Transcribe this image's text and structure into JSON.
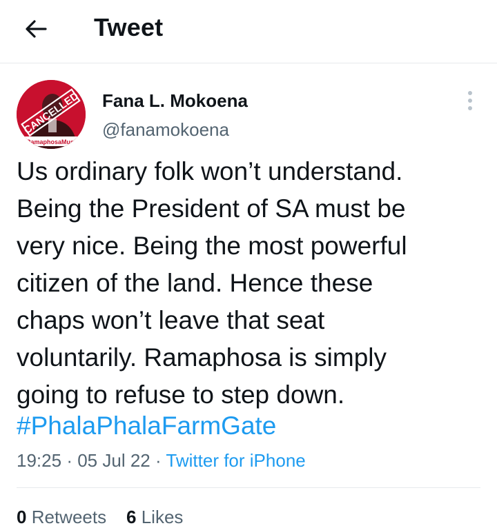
{
  "header": {
    "title": "Tweet",
    "back_icon": "arrow-left-icon"
  },
  "tweet": {
    "author_name": "Fana L. Mokoena",
    "author_handle": "@fanamokoena",
    "avatar": {
      "stamp_text": "CANCELLED",
      "banner_text": "RamaphosaMust"
    },
    "text": "Us ordinary folk won’t understand.\nBeing the President of SA must be\nvery nice. Being the most powerful\ncitizen of the land. Hence these\nchaps won’t leave that seat\nvoluntarily. Ramaphosa is simply\ngoing to refuse to step down.",
    "hashtag": "#PhalaPhalaFarmGate",
    "time": "19:25",
    "date": "05 Jul 22",
    "separator": "·",
    "source": "Twitter for iPhone",
    "retweets_count": "0",
    "retweets_label": "Retweets",
    "likes_count": "6",
    "likes_label": "Likes"
  },
  "colors": {
    "link": "#1d9bf0",
    "secondary_text": "#536471",
    "primary_text": "#0f1419",
    "avatar_red": "#c8102e"
  }
}
